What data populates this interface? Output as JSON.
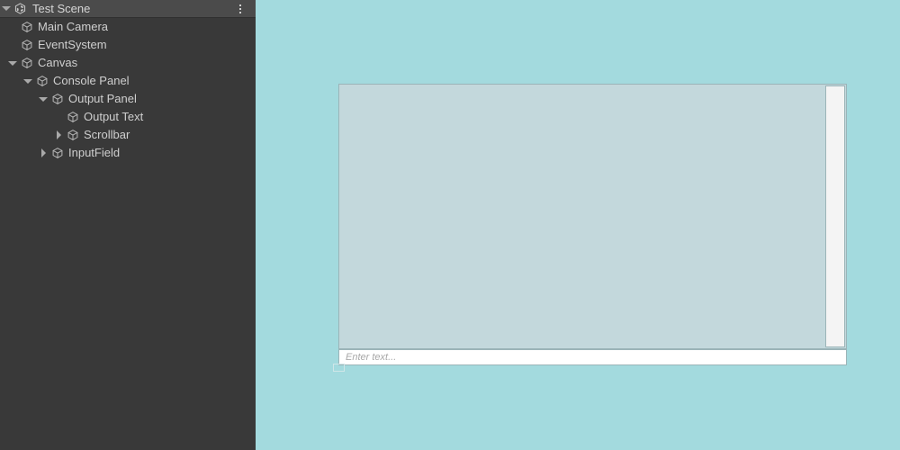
{
  "hierarchy": {
    "header": {
      "scene_name": "Test Scene",
      "scene_icon": "unity-scene-icon",
      "foldout_icon": "triangle-down-icon",
      "menu_icon": "kebab-menu-icon"
    },
    "items": [
      {
        "label": "Main Camera",
        "depth": 1,
        "arrow": "none",
        "icon": "gameobject-cube-icon"
      },
      {
        "label": "EventSystem",
        "depth": 1,
        "arrow": "none",
        "icon": "gameobject-cube-icon"
      },
      {
        "label": "Canvas",
        "depth": 1,
        "arrow": "down",
        "icon": "gameobject-cube-icon"
      },
      {
        "label": "Console Panel",
        "depth": 2,
        "arrow": "down",
        "icon": "gameobject-cube-icon"
      },
      {
        "label": "Output Panel",
        "depth": 3,
        "arrow": "down",
        "icon": "gameobject-cube-icon"
      },
      {
        "label": "Output Text",
        "depth": 4,
        "arrow": "none",
        "icon": "gameobject-cube-icon"
      },
      {
        "label": "Scrollbar",
        "depth": 4,
        "arrow": "right",
        "icon": "gameobject-cube-icon"
      },
      {
        "label": "InputField",
        "depth": 3,
        "arrow": "right",
        "icon": "gameobject-cube-icon"
      }
    ]
  },
  "game_view": {
    "background_color": "#a3dade",
    "console": {
      "panel_color": "#c3d8dc",
      "border_color": "#9bb4b8",
      "output_text": "",
      "scrollbar_color": "#f4f4f4"
    },
    "input": {
      "value": "",
      "placeholder": "Enter text...",
      "background_color": "#ffffff"
    }
  }
}
